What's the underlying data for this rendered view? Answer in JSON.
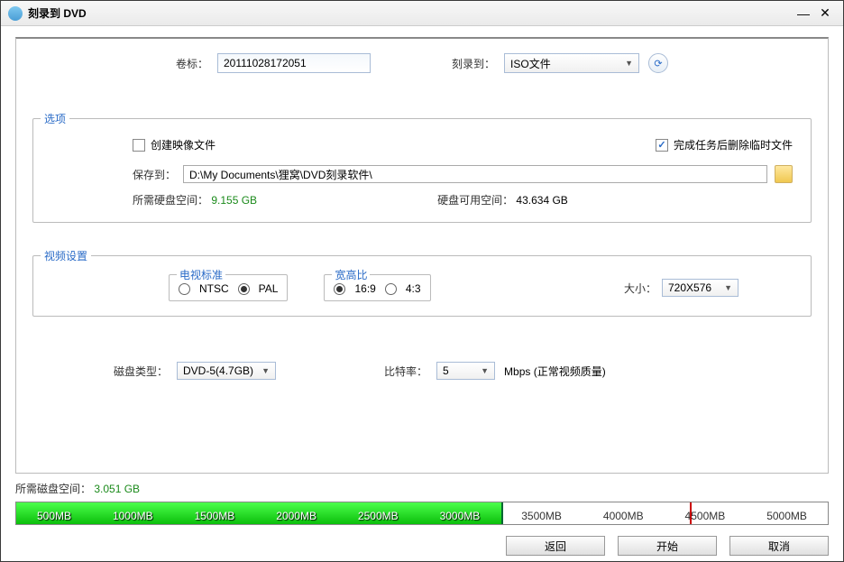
{
  "window": {
    "title": "刻录到 DVD"
  },
  "top": {
    "volume_label": "卷标：",
    "volume_value": "20111028172051",
    "burn_label": "刻录到：",
    "burn_value": "ISO文件"
  },
  "options": {
    "legend": "选项",
    "create_image": "创建映像文件",
    "delete_temp": "完成任务后删除临时文件",
    "save_to_label": "保存到：",
    "save_to_value": "D:\\My Documents\\狸窝\\DVD刻录软件\\",
    "need_space_label": "所需硬盘空间：",
    "need_space_value": "9.155 GB",
    "free_space_label": "硬盘可用空间：",
    "free_space_value": "43.634 GB"
  },
  "video": {
    "legend": "视频设置",
    "tv_legend": "电视标准",
    "ntsc": "NTSC",
    "pal": "PAL",
    "aspect_legend": "宽高比",
    "r169": "16:9",
    "r43": "4:3",
    "size_label": "大小：",
    "size_value": "720X576"
  },
  "mid": {
    "disk_type_label": "磁盘类型：",
    "disk_type_value": "DVD-5(4.7GB)",
    "bitrate_label": "比特率：",
    "bitrate_value": "5",
    "bitrate_unit": "Mbps (正常视频质量)"
  },
  "footer": {
    "need_label": "所需磁盘空间：",
    "need_value": "3.051 GB",
    "ticks": [
      "500MB",
      "1000MB",
      "1500MB",
      "2000MB",
      "2500MB",
      "3000MB",
      "3500MB",
      "4000MB",
      "4500MB",
      "5000MB"
    ]
  },
  "buttons": {
    "back": "返回",
    "start": "开始",
    "cancel": "取消"
  }
}
